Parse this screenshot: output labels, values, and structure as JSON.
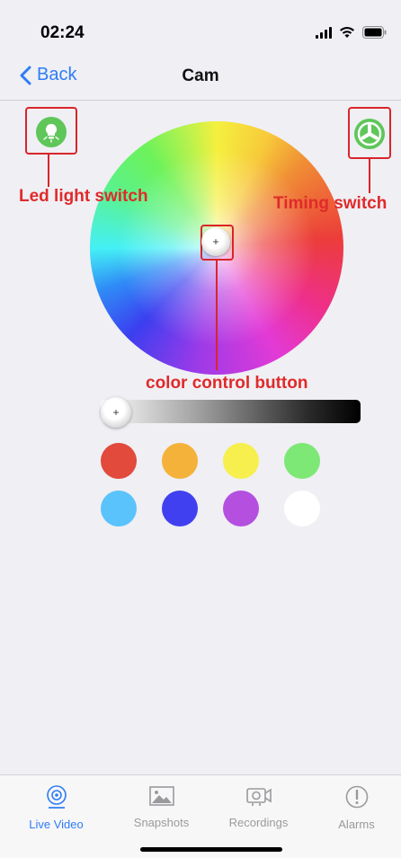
{
  "status": {
    "time": "02:24"
  },
  "nav": {
    "back_label": "Back",
    "title": "Cam"
  },
  "annotations": {
    "led": "Led light switch",
    "timing": "Timing switch",
    "color_button": "color control button"
  },
  "brightness": {
    "level": 0
  },
  "swatches": {
    "row1": [
      "#e24a3b",
      "#f4b23a",
      "#f7ef4d",
      "#7ee876"
    ],
    "row2": [
      "#5ac3fb",
      "#4040f0",
      "#b44fe0",
      "#ffffff"
    ]
  },
  "tabs": [
    {
      "label": "Live Video",
      "active": true
    },
    {
      "label": "Snapshots",
      "active": false
    },
    {
      "label": "Recordings",
      "active": false
    },
    {
      "label": "Alarms",
      "active": false
    }
  ],
  "colors": {
    "accent": "#2f7cf6",
    "annotation": "#e02a2a",
    "switch_green": "#5fc65a"
  }
}
